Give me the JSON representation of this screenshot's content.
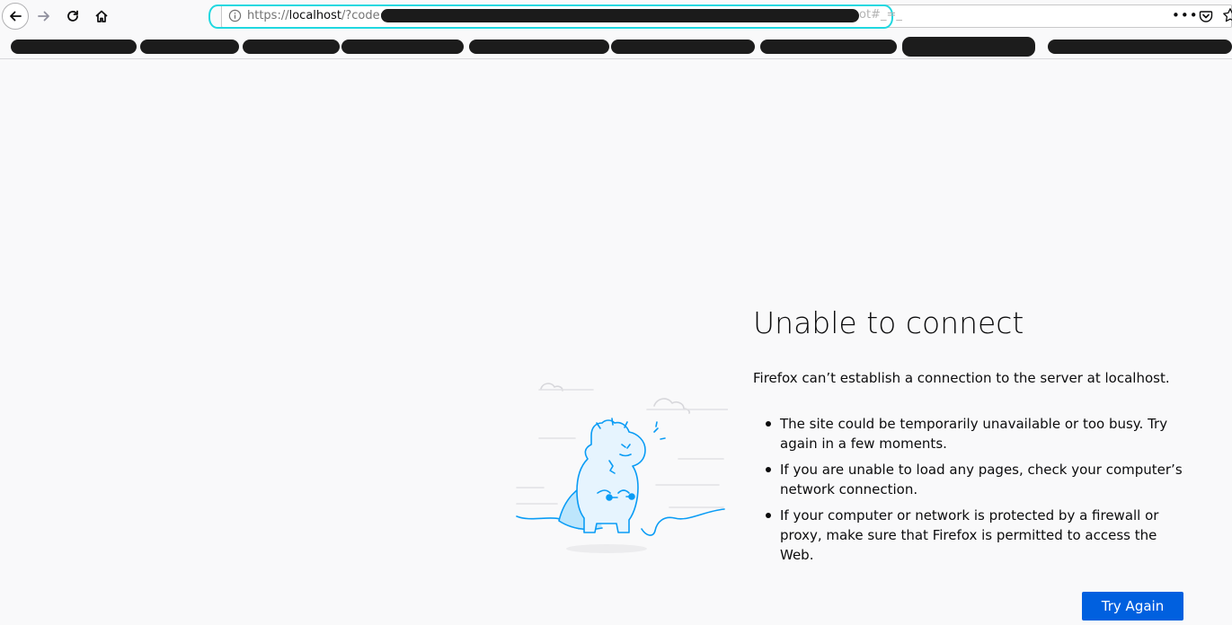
{
  "toolbar": {
    "url_prefix": "https://",
    "url_host": "localhost",
    "url_path": "/?code=7",
    "url_tail": "ot#_=_",
    "page_actions": "•••"
  },
  "error_page": {
    "title": "Unable to connect",
    "description": "Firefox can’t establish a connection to the server at localhost.",
    "bullets": [
      "The site could be temporarily unavailable or too busy. Try again in a few moments.",
      "If you are unable to load any pages, check your computer’s network connection.",
      "If your computer or network is protected by a firewall or proxy, make sure that Firefox is permitted to access the Web."
    ],
    "try_again_label": "Try Again"
  },
  "colors": {
    "accent": "#0060df",
    "background": "#f9f9fa",
    "illustration": "#0a9cf5",
    "highlight": "#20d8e0"
  },
  "icons": {
    "back": "back-arrow-icon",
    "forward": "forward-arrow-icon",
    "reload": "reload-icon",
    "home": "home-icon",
    "info": "info-icon",
    "pocket": "pocket-icon",
    "bookmark": "star-icon"
  }
}
